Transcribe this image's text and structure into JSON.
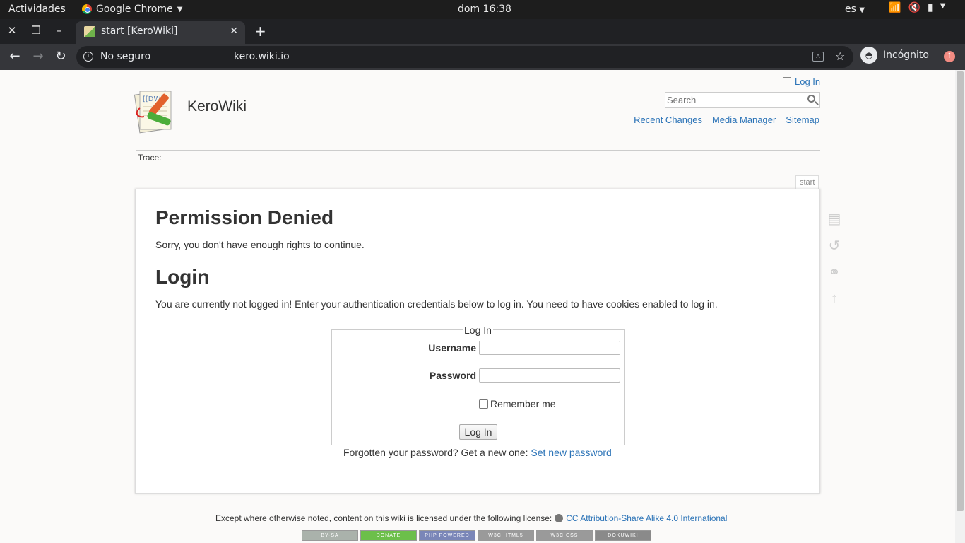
{
  "gnome": {
    "activities": "Actividades",
    "app_name": "Google Chrome",
    "clock": "dom 16:38",
    "language": "es"
  },
  "browser": {
    "tab_title": "start [KeroWiki]",
    "security": "No seguro",
    "url": "kero.wiki.io",
    "profile": "Incógnito"
  },
  "wiki": {
    "site_title": "KeroWiki",
    "login_link": "Log In",
    "search_placeholder": "Search",
    "nav": [
      "Recent Changes",
      "Media Manager",
      "Sitemap"
    ],
    "breadcrumb": "Trace:",
    "page_id": "start",
    "h1": "Permission Denied",
    "p1": "Sorry, you don't have enough rights to continue.",
    "h2": "Login",
    "p2": "You are currently not logged in! Enter your authentication credentials below to log in. You need to have cookies enabled to log in.",
    "form": {
      "legend": "Log In",
      "username_label": "Username",
      "password_label": "Password",
      "remember_label": "Remember me",
      "submit_label": "Log In",
      "forgot_text": "Forgotten your password? Get a new one:",
      "forgot_link": "Set new password"
    },
    "footer": {
      "license_text": "Except where otherwise noted, content on this wiki is licensed under the following license:",
      "license_link": "CC Attribution-Share Alike 4.0 International",
      "badges": [
        "BY-SA",
        "DONATE",
        "PHP POWERED",
        "W3C HTML5",
        "W3C CSS",
        "DOKUWIKI"
      ]
    }
  },
  "colors": {
    "link": "#2b73b7",
    "chrome_dark": "#202124",
    "chrome_toolbar": "#35363a"
  }
}
